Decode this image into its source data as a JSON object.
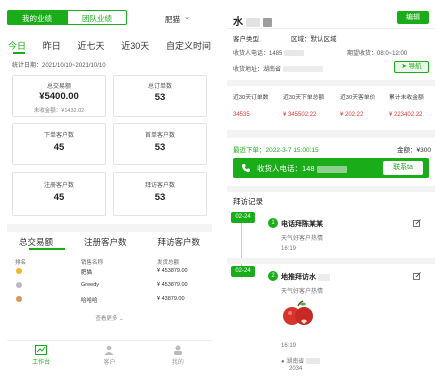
{
  "left": {
    "top_tabs": [
      "我的业绩",
      "团队业绩"
    ],
    "user": "肥猫",
    "date_tabs": [
      "今日",
      "昨日",
      "近七天",
      "近30天",
      "自定义时间"
    ],
    "period": "统计日期：2021/10/10~2021/10/10",
    "cards": [
      {
        "label": "总交易额",
        "value": "¥5400.00",
        "sub": "未收金额：¥1432.02"
      },
      {
        "label": "总订单数",
        "value": "53",
        "sub": ""
      },
      {
        "label": "下单客户数",
        "value": "45",
        "sub": ""
      },
      {
        "label": "首单客户数",
        "value": "53",
        "sub": ""
      },
      {
        "label": "注册客户数",
        "value": "45",
        "sub": ""
      },
      {
        "label": "拜访客户数",
        "value": "53",
        "sub": ""
      }
    ],
    "rank_tabs": [
      "总交易额",
      "注册客户数",
      "拜访客户数"
    ],
    "rank_head": {
      "rank": "排名",
      "name": "销售名称",
      "amount": "发货总额"
    },
    "rank_rows": [
      {
        "name": "肥猫",
        "amount": "¥ 453879.00",
        "medal": "#f3b530"
      },
      {
        "name": "Greedy",
        "amount": "¥ 453879.00",
        "medal": "#b9b9c6"
      },
      {
        "name": "哈哈哈",
        "amount": "¥ 43879.00",
        "medal": "#d6955b"
      }
    ],
    "see_more": "查看更多",
    "nav": [
      "工作台",
      "客户",
      "我的"
    ]
  },
  "right": {
    "name": "水",
    "edit": "编辑",
    "type_label": "客户类型",
    "area_label": "区域：默认区域",
    "phone_label": "收货人电话：1485",
    "expect_label": "期望收货：08:0~12:00",
    "addr_label": "收货地址：湖南省",
    "nav_btn": "导航",
    "stats_head": [
      "近30天订单数",
      "近30天下单总额",
      "近30天客单价",
      "累计未收金额"
    ],
    "stats_vals": [
      "34535",
      "¥ 345502:22",
      "¥ 202.22",
      "¥ 223402.22"
    ],
    "next_order": "最近下单：2022-3-7  15:00:15",
    "plan_amt": "金额：¥300",
    "phone_bar": "收货人电话：148",
    "call": "联系ta",
    "visit_title": "拜访记录",
    "visits": [
      {
        "date": "02-24",
        "num": "1",
        "title": "电话拜陈某某",
        "sub": "天气好客户热情",
        "time": "16:19"
      },
      {
        "date": "02-24",
        "num": "2",
        "title": "地推拜访水",
        "sub": "天气好客户热情",
        "time": "16:19",
        "loc": "湖南省",
        "code": "2034"
      }
    ]
  },
  "colors": {
    "accent": "#1aad19",
    "negative": "#e53935"
  }
}
